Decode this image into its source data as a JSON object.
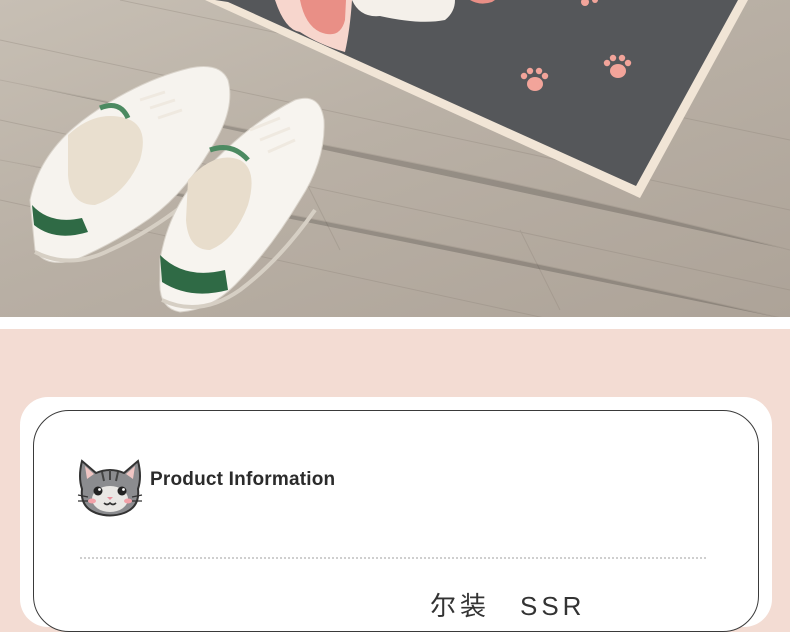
{
  "photo": {
    "description_icon": "shoes-on-rug-photo"
  },
  "info": {
    "heading": "Product Information",
    "bottom_partial": "尔装　SSR"
  },
  "colors": {
    "background_pink": "#f3dcd3",
    "rug_gray": "#55575a",
    "paw_pink": "#f2a49a",
    "stripe_green": "#2f6a45"
  }
}
